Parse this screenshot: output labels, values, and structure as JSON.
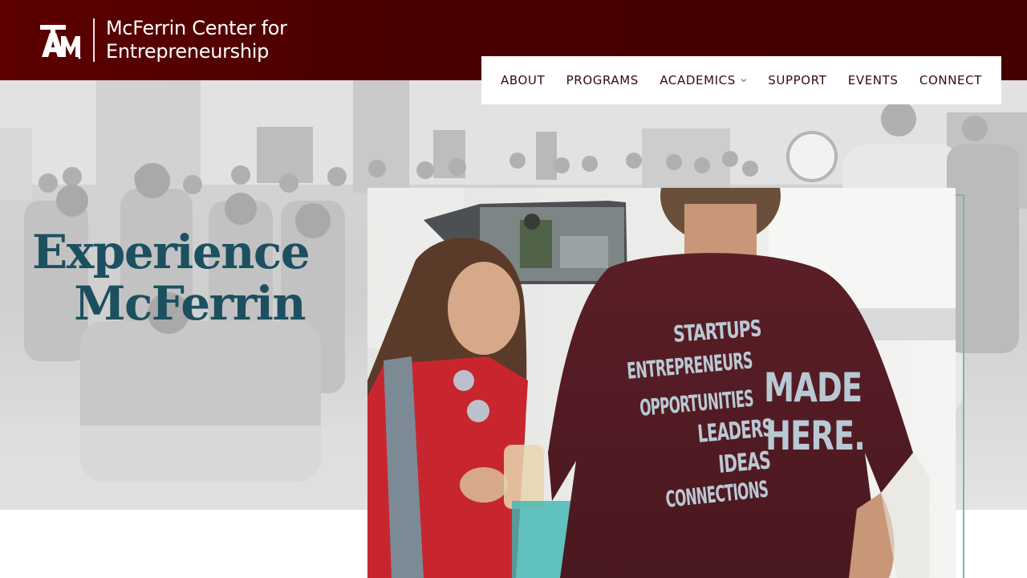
{
  "brand": {
    "logo_mark": "ATM",
    "name_line1": "McFerrin Center for",
    "name_line2": "Entrepreneurship"
  },
  "nav": {
    "items": [
      {
        "label": "ABOUT"
      },
      {
        "label": "PROGRAMS"
      },
      {
        "label": "ACADEMICS",
        "has_dropdown": true
      },
      {
        "label": "SUPPORT"
      },
      {
        "label": "EVENTS"
      },
      {
        "label": "CONNECT"
      }
    ]
  },
  "hero": {
    "headline_line1": "Experience",
    "headline_line2": "McFerrin",
    "shirt": {
      "left_words": [
        "STARTUPS",
        "ENTREPRENEURS",
        "OPPORTUNITIES",
        "LEADERS",
        "IDEAS",
        "CONNECTIONS"
      ],
      "right_line1": "MADE",
      "right_line2": "HERE."
    }
  },
  "colors": {
    "header": "#4a0000",
    "headline": "#1c5060",
    "nav_text": "#3a0a0a",
    "frame_accent": "#7fb0b0"
  }
}
